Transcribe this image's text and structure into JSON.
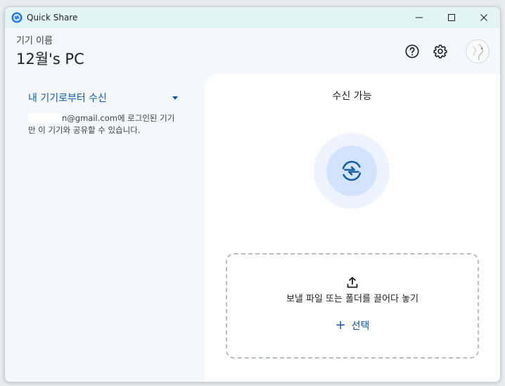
{
  "window": {
    "title": "Quick Share",
    "controls": {
      "minimize_icon": "minimize-icon",
      "maximize_icon": "maximize-icon",
      "close_icon": "close-icon"
    }
  },
  "header": {
    "device_label": "기기 이름",
    "device_name": "12월's PC",
    "help_icon": "help-icon",
    "settings_icon": "gear-icon",
    "avatar_icon": "avatar"
  },
  "sidebar": {
    "receive_option": "내 기기로부터 수신",
    "description_line1_suffix": "n@gmail.com에 로그인된 기기",
    "description_line2": "만 이 기기와 공유할 수 있습니다."
  },
  "main": {
    "status": "수신 가능",
    "status_icon": "sync-arrows-icon",
    "dropzone": {
      "text": "보낼 파일 또는 폴더를 끌어다 놓기",
      "select_label": "선택",
      "plus_symbol": "+",
      "upload_icon": "upload-icon"
    }
  },
  "colors": {
    "accent": "#0e5aa7",
    "titlebar": "#e2f4f3",
    "sidebar_bg": "#f4f8fd",
    "halo_outer": "#eef3fd",
    "halo_inner": "#d3e3fd"
  }
}
